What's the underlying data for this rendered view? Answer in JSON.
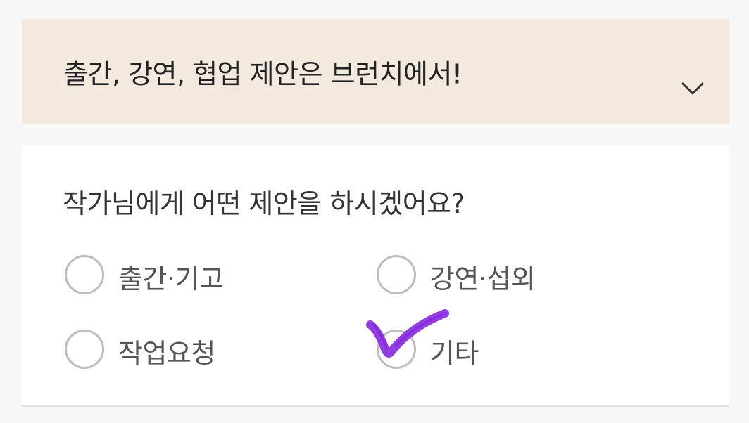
{
  "accordion": {
    "title": "출간, 강연, 협업 제안은 브런치에서!",
    "expand_icon": "chevron-down-icon",
    "background": "#f3e9df"
  },
  "proposal": {
    "question": "작가님에게 어떤 제안을 하시겠어요?",
    "options": [
      {
        "label": "출간·기고",
        "selected": false
      },
      {
        "label": "강연·섭외",
        "selected": false
      },
      {
        "label": "작업요청",
        "selected": false
      },
      {
        "label": "기타",
        "selected": true
      }
    ],
    "selection_mark": "handdrawn-check-icon",
    "selection_mark_color": "#8a2be2"
  }
}
